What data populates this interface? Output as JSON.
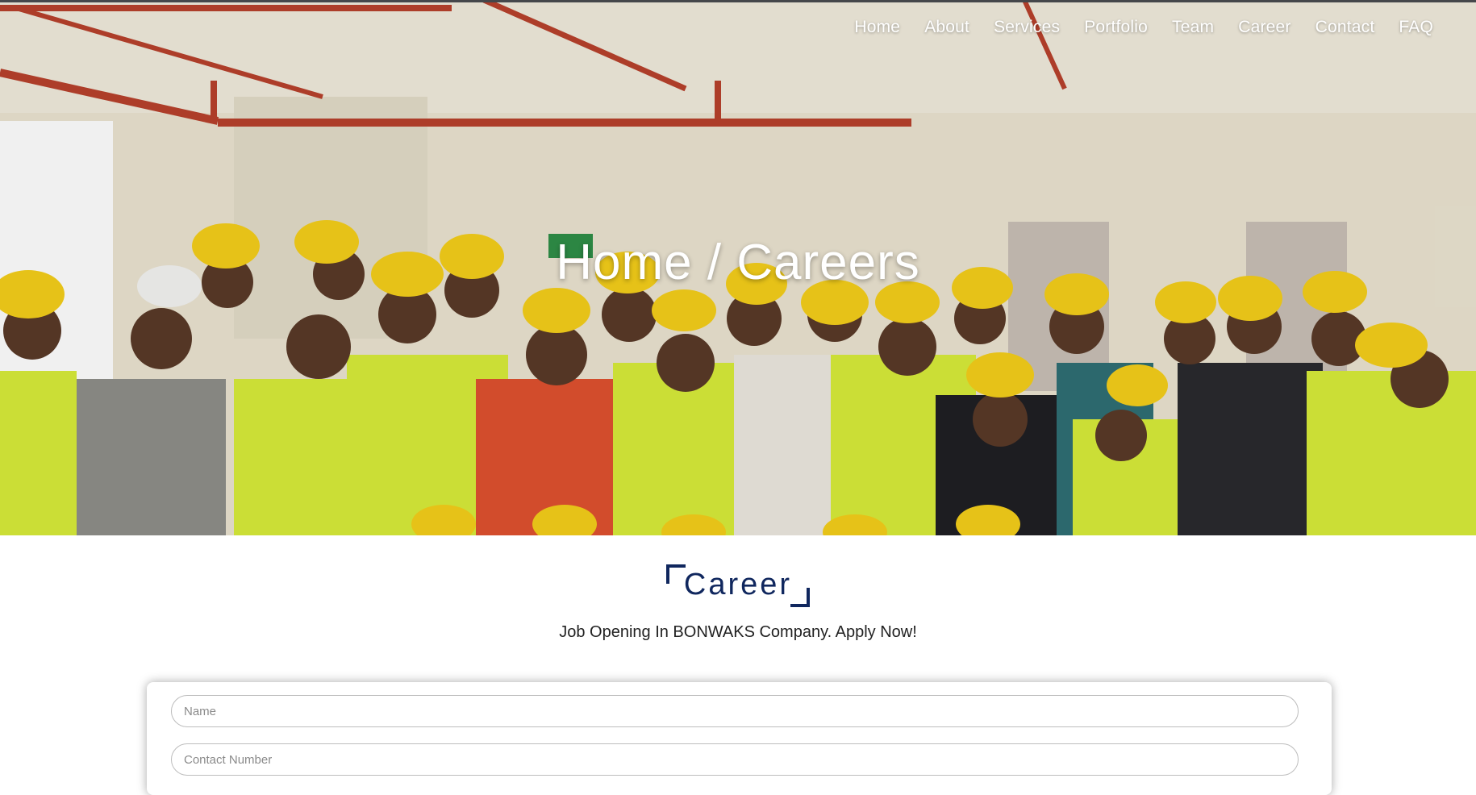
{
  "nav": {
    "items": [
      "Home",
      "About",
      "Services",
      "Portfolio",
      "Team",
      "Career",
      "Contact",
      "FAQ"
    ]
  },
  "hero": {
    "title": "Home / Careers"
  },
  "section": {
    "title": "Career",
    "subtitle": "Job Opening In BONWAKS Company. Apply Now!"
  },
  "form": {
    "name_placeholder": "Name",
    "contact_placeholder": "Contact Number"
  },
  "colors": {
    "accent": "#10275e",
    "helmet": "#f5cf1a",
    "vest": "#d8ec3a",
    "pipe": "#b8412c"
  }
}
